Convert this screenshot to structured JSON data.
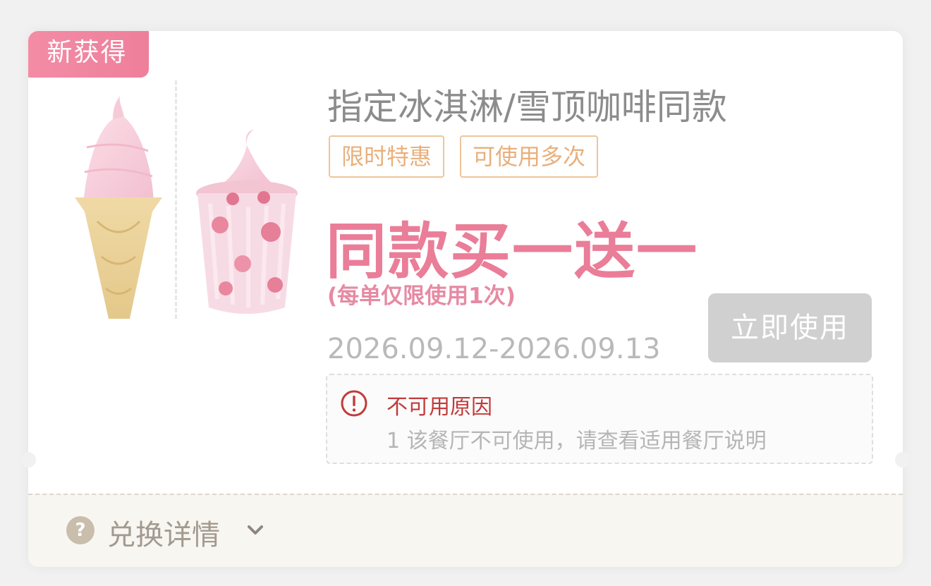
{
  "badge": {
    "label": "新获得"
  },
  "coupon": {
    "title": "指定冰淇淋/雪顶咖啡同款",
    "tags": [
      "限时特惠",
      "可使用多次"
    ],
    "offer": "同款买一送一",
    "limit": "(每单仅限使用1次)",
    "validity": "2026.09.12-2026.09.13",
    "use_button": "立即使用"
  },
  "unavailable": {
    "title": "不可用原因",
    "detail": "1 该餐厅不可使用，请查看适用餐厅说明"
  },
  "footer": {
    "label": "兑换详情",
    "help_symbol": "?"
  },
  "colors": {
    "accent": "#ea7d98",
    "tag_border": "#f0c49c",
    "warning": "#c23a3a",
    "button_disabled": "#d0d0d0"
  },
  "icons": [
    "alert-circle-icon",
    "question-circle-icon",
    "chevron-down-icon"
  ]
}
